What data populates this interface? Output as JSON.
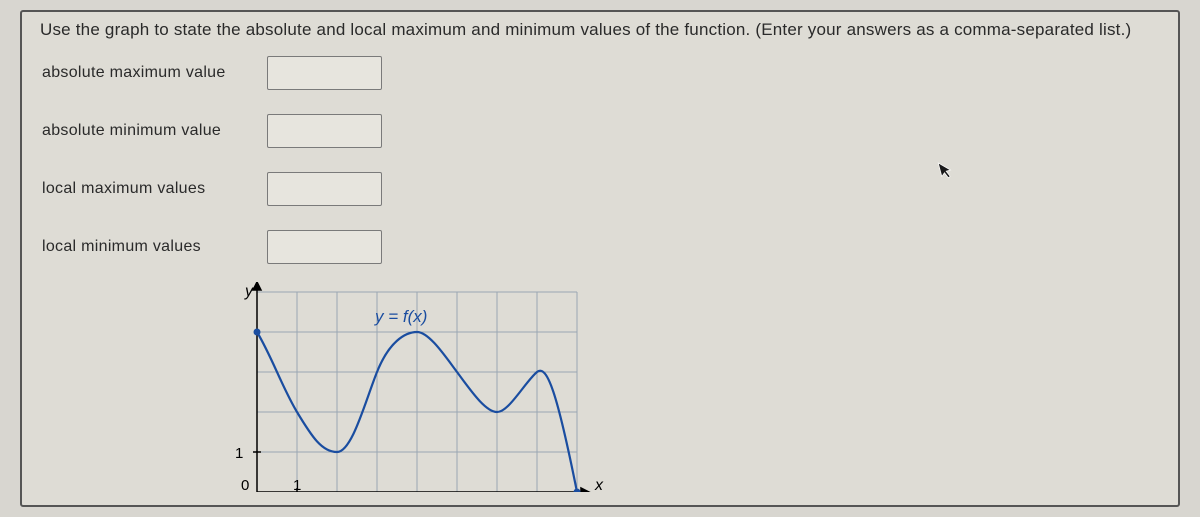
{
  "question_text": "Use the graph to state the absolute and local maximum and minimum values of the function. (Enter your answers as a comma-separated list.)",
  "fields": {
    "abs_max_label": "absolute maximum value",
    "abs_min_label": "absolute minimum value",
    "local_max_label": "local maximum values",
    "local_min_label": "local minimum values",
    "abs_max_value": "",
    "abs_min_value": "",
    "local_max_value": "",
    "local_min_value": ""
  },
  "graph": {
    "y_axis_label": "y",
    "x_axis_label": "x",
    "origin_label": "0",
    "tick_x_label": "1",
    "tick_y_label": "1",
    "function_label": "y = f(x)"
  },
  "chart_data": {
    "type": "line",
    "title": "y = f(x)",
    "xlabel": "x",
    "ylabel": "y",
    "xlim": [
      0,
      8
    ],
    "ylim": [
      0,
      5
    ],
    "x_ticks": [
      0,
      1
    ],
    "y_ticks": [
      1
    ],
    "grid": true,
    "series": [
      {
        "name": "f(x)",
        "points": [
          {
            "x": 0,
            "y": 4,
            "endpoint": "closed"
          },
          {
            "x": 1,
            "y": 2
          },
          {
            "x": 2,
            "y": 1
          },
          {
            "x": 3,
            "y": 3
          },
          {
            "x": 4,
            "y": 4
          },
          {
            "x": 5,
            "y": 3
          },
          {
            "x": 6,
            "y": 2
          },
          {
            "x": 7,
            "y": 3
          },
          {
            "x": 8,
            "y": 0,
            "endpoint": "closed"
          }
        ]
      }
    ],
    "absolute_maximum": 4,
    "absolute_minimum": 0,
    "local_maxima": [
      4,
      3
    ],
    "local_minima": [
      1,
      2
    ]
  }
}
